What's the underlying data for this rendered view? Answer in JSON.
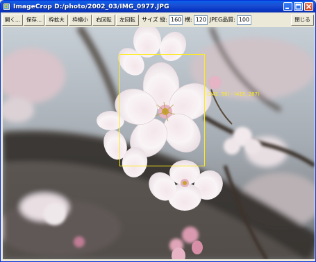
{
  "window": {
    "title": "ImageCrop D:/photo/2002_03/IMG_0977.JPG"
  },
  "toolbar": {
    "open_label": "開く...",
    "save_label": "保存...",
    "enlarge_label": "枠拡大",
    "shrink_label": "枠縮小",
    "rotate_right_label": "右回転",
    "rotate_left_label": "左回転",
    "size_label": "サイズ 縦:",
    "height_value": "160",
    "width_label": "横:",
    "width_value": "120",
    "quality_label": "JPEG品質:",
    "quality_value": "100",
    "close_label": "閉じる"
  },
  "crop": {
    "coords_text": "(242, 56) - (415, 287)"
  },
  "colors": {
    "crop_border": "#ffeb1a",
    "titlebar": "#0a5fe8"
  },
  "icons": [
    "app-icon",
    "minimize-icon",
    "maximize-icon",
    "close-icon"
  ]
}
